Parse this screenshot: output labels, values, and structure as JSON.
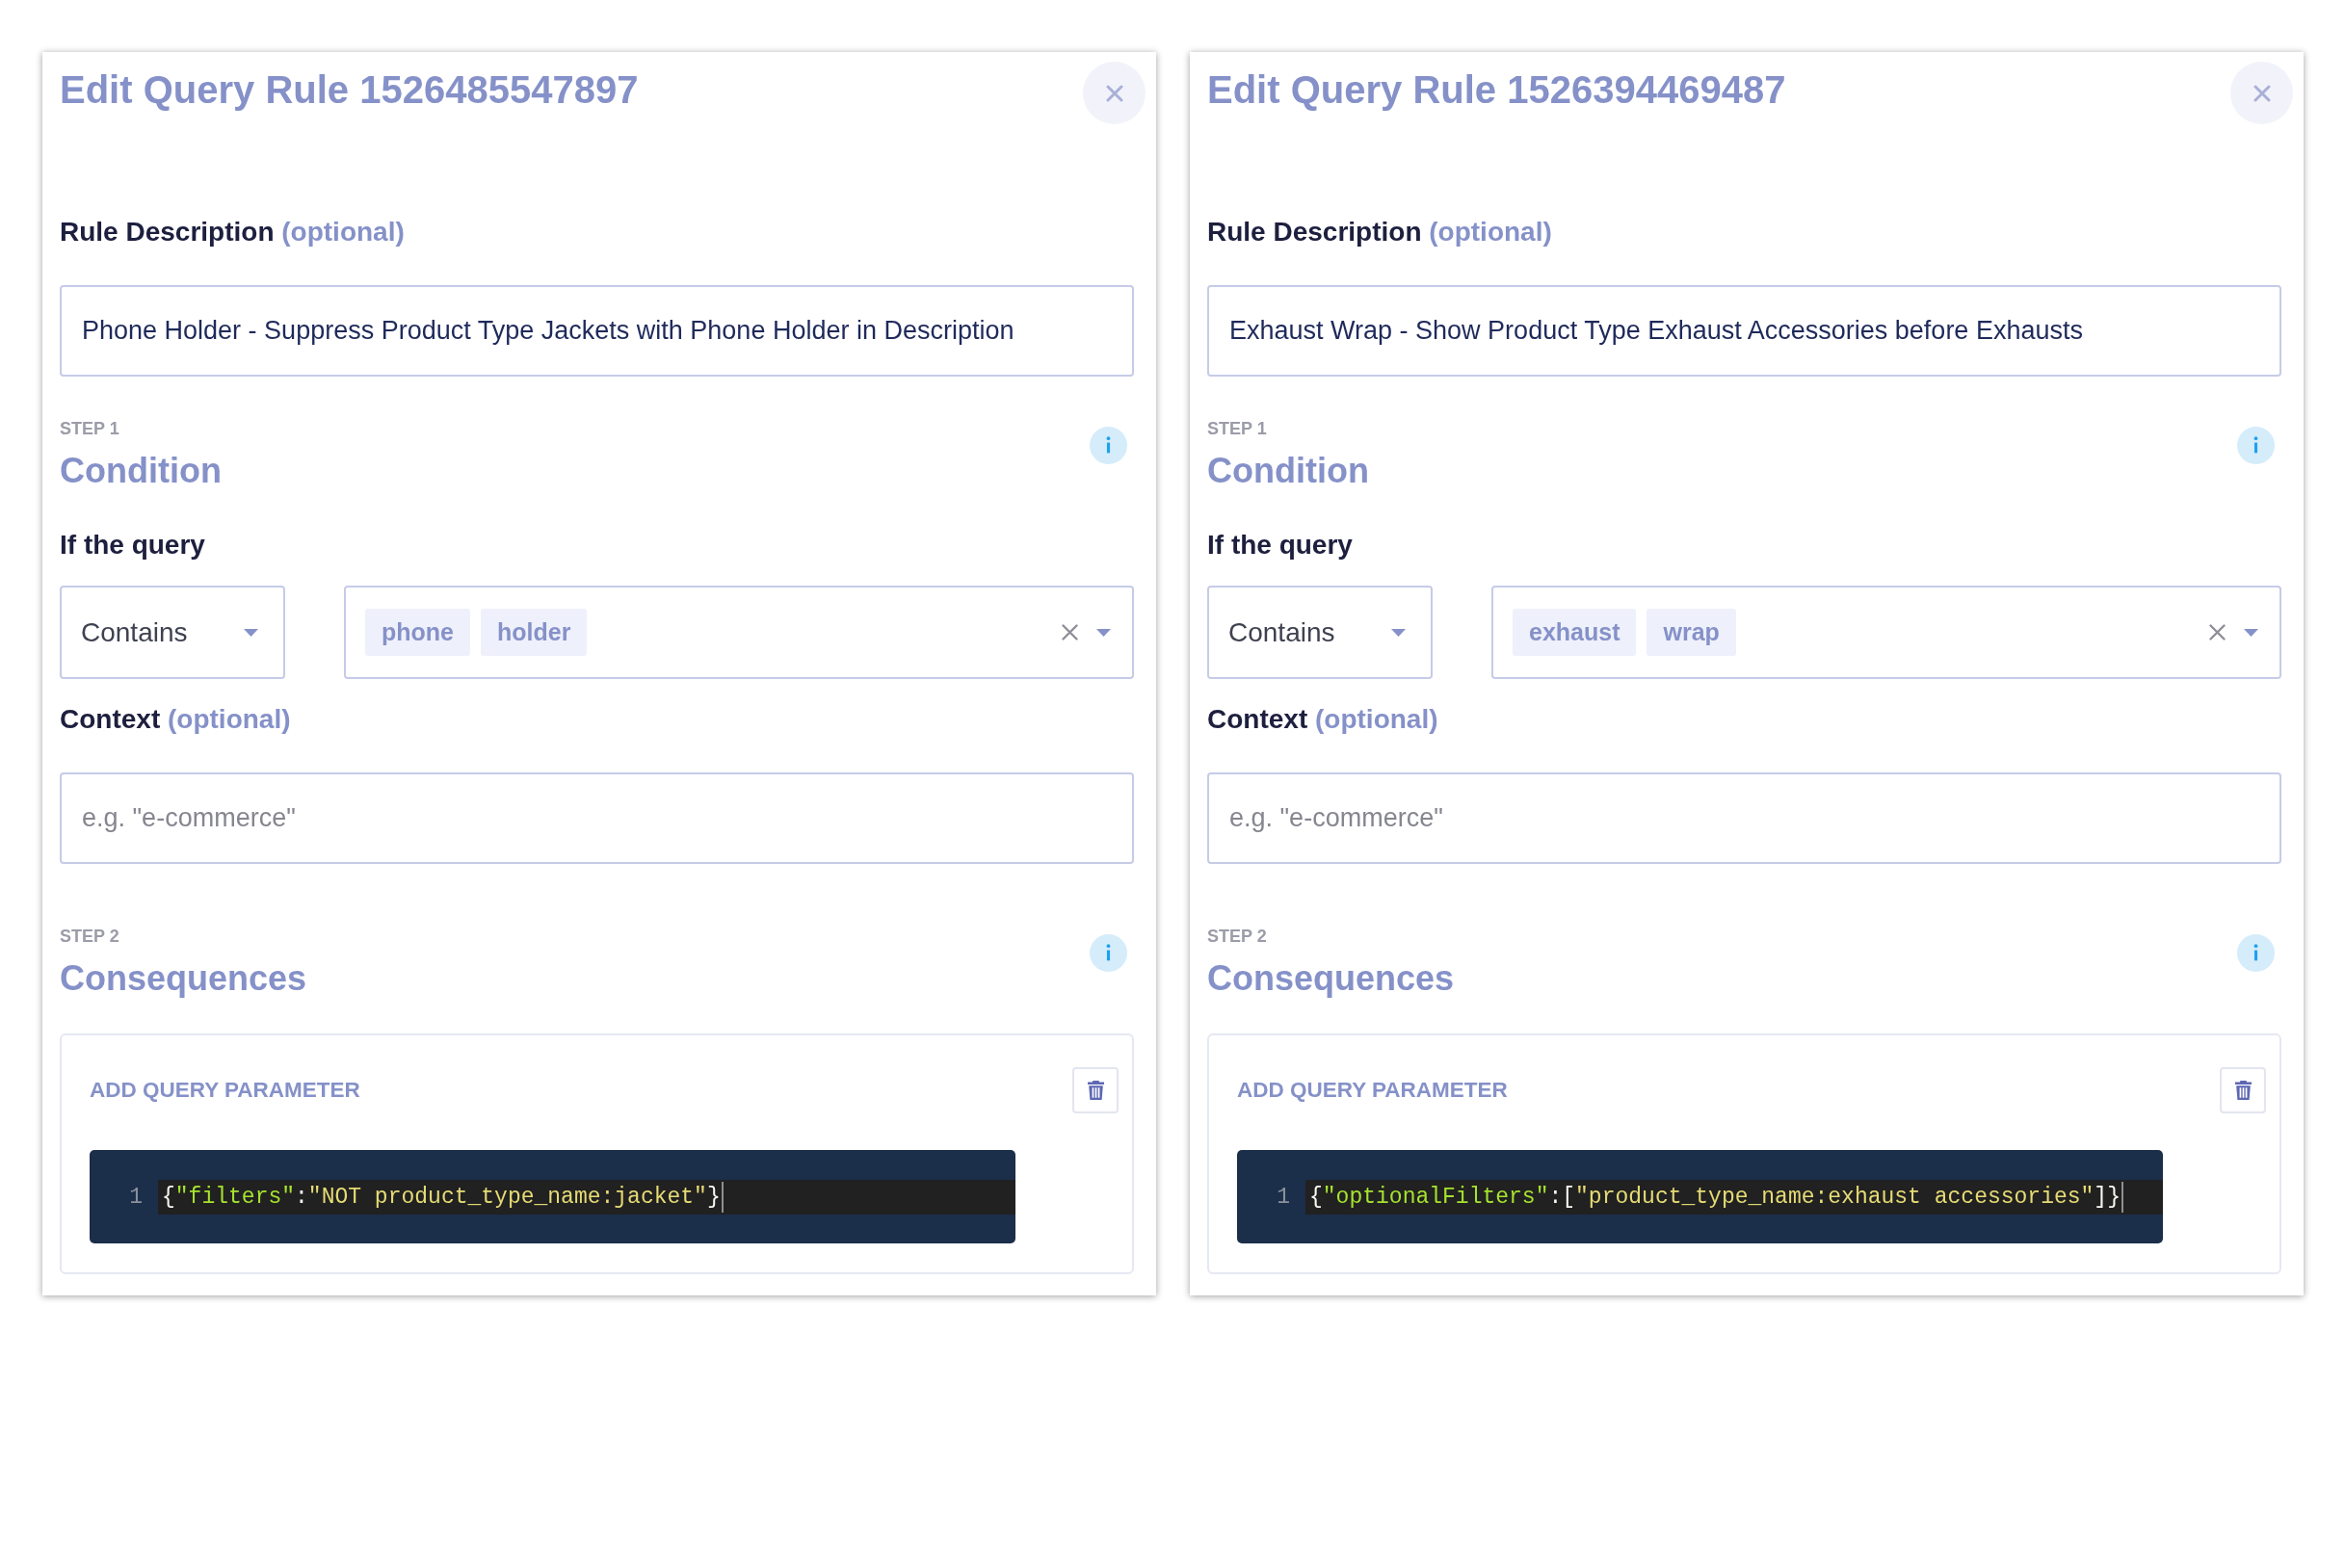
{
  "panels": [
    {
      "title": "Edit Query Rule 1526485547897",
      "description": {
        "label": "Rule Description",
        "hint": "(optional)",
        "value": "Phone Holder - Suppress Product Type Jackets with Phone Holder in Description"
      },
      "condition": {
        "step": "STEP 1",
        "title": "Condition",
        "query_label": "If the query",
        "operator": "Contains",
        "tags": [
          "phone",
          "holder"
        ],
        "context": {
          "label": "Context",
          "hint": "(optional)",
          "placeholder": "e.g. \"e-commerce\""
        }
      },
      "consequences": {
        "step": "STEP 2",
        "title": "Consequences",
        "card_title": "ADD QUERY PARAMETER",
        "editor": {
          "line_number": "1",
          "tokens": [
            {
              "kind": "punctuation",
              "text": "{"
            },
            {
              "kind": "key",
              "text": "\"filters\""
            },
            {
              "kind": "punctuation",
              "text": ":"
            },
            {
              "kind": "string",
              "text": "\"NOT product_type_name:jacket\""
            },
            {
              "kind": "punctuation",
              "text": "}"
            }
          ]
        }
      }
    },
    {
      "title": "Edit Query Rule 1526394469487",
      "description": {
        "label": "Rule Description",
        "hint": "(optional)",
        "value": "Exhaust Wrap - Show Product Type Exhaust Accessories before Exhausts"
      },
      "condition": {
        "step": "STEP 1",
        "title": "Condition",
        "query_label": "If the query",
        "operator": "Contains",
        "tags": [
          "exhaust",
          "wrap"
        ],
        "context": {
          "label": "Context",
          "hint": "(optional)",
          "placeholder": "e.g. \"e-commerce\""
        }
      },
      "consequences": {
        "step": "STEP 2",
        "title": "Consequences",
        "card_title": "ADD QUERY PARAMETER",
        "editor": {
          "line_number": "1",
          "tokens": [
            {
              "kind": "punctuation",
              "text": "{"
            },
            {
              "kind": "key",
              "text": "\"optionalFilters\""
            },
            {
              "kind": "punctuation",
              "text": ":["
            },
            {
              "kind": "string",
              "text": "\"product_type_name:exhaust accessories\""
            },
            {
              "kind": "punctuation",
              "text": "]}"
            }
          ]
        }
      }
    }
  ]
}
